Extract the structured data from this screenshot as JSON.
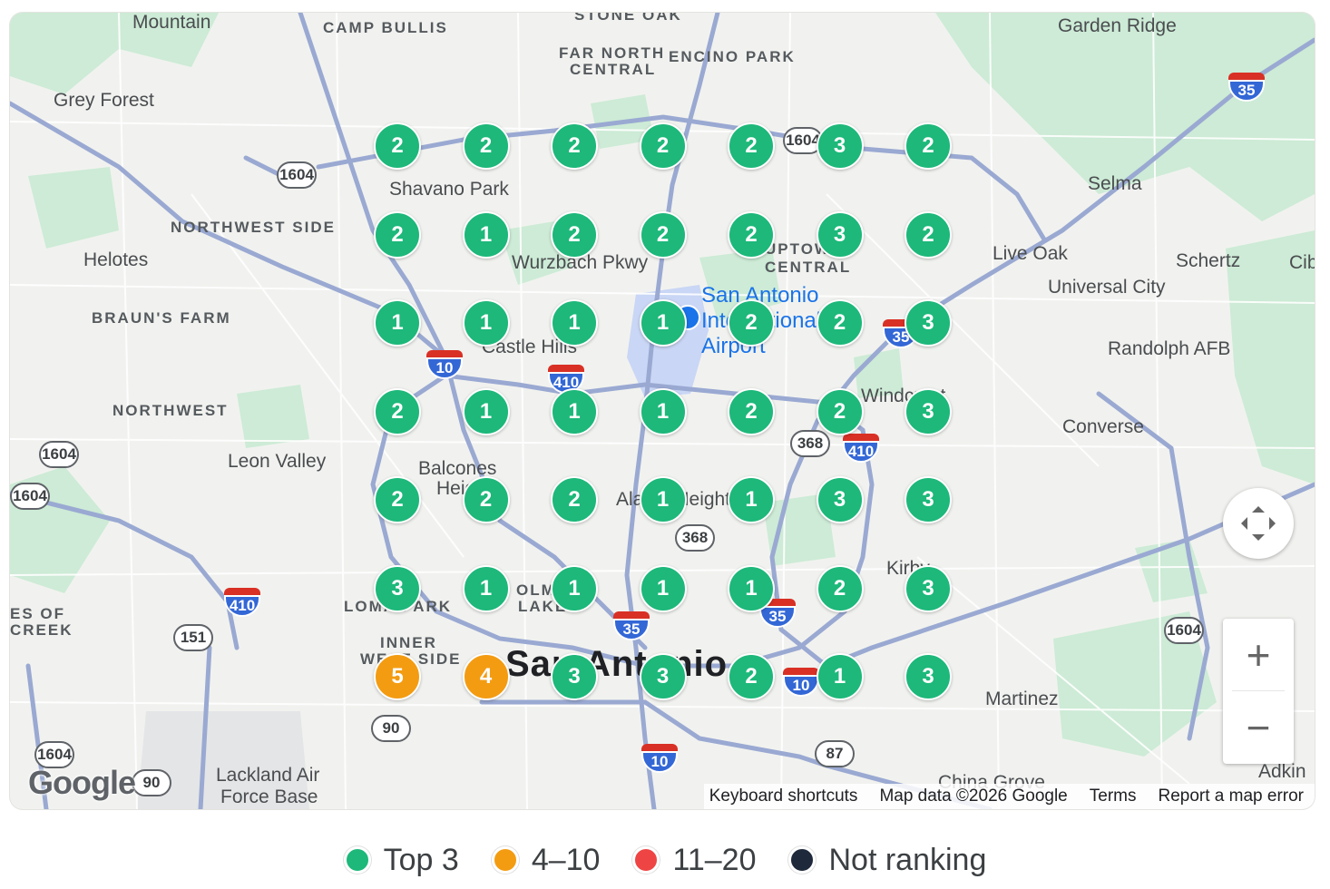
{
  "map": {
    "place_labels": [
      {
        "text": "Mountain",
        "cls": "lbl"
      },
      {
        "text": "CAMP BULLIS",
        "cls": "lbl caps"
      },
      {
        "text": "STONE OAK",
        "cls": "lbl caps"
      },
      {
        "text": "FAR NORTH",
        "cls": "lbl caps"
      },
      {
        "text": "CENTRAL",
        "cls": "lbl caps"
      },
      {
        "text": "ENCINO PARK",
        "cls": "lbl caps"
      },
      {
        "text": "Garden Ridge",
        "cls": "lbl"
      },
      {
        "text": "Grey Forest",
        "cls": "lbl"
      },
      {
        "text": "Shavano Park",
        "cls": "lbl"
      },
      {
        "text": "NORTHWEST SIDE",
        "cls": "lbl caps"
      },
      {
        "text": "Helotes",
        "cls": "lbl"
      },
      {
        "text": "Wurzbach Pkwy",
        "cls": "lbl"
      },
      {
        "text": "UPTOWN",
        "cls": "lbl caps"
      },
      {
        "text": "CENTRAL",
        "cls": "lbl caps"
      },
      {
        "text": "Selma",
        "cls": "lbl"
      },
      {
        "text": "Live Oak",
        "cls": "lbl"
      },
      {
        "text": "Schertz",
        "cls": "lbl"
      },
      {
        "text": "Cib",
        "cls": "lbl"
      },
      {
        "text": "Universal City",
        "cls": "lbl"
      },
      {
        "text": "BRAUN'S FARM",
        "cls": "lbl caps"
      },
      {
        "text": "Castle Hills",
        "cls": "lbl"
      },
      {
        "text": "Randolph AFB",
        "cls": "lbl"
      },
      {
        "text": "NORTHWEST",
        "cls": "lbl caps"
      },
      {
        "text": "Windcrest",
        "cls": "lbl"
      },
      {
        "text": "Converse",
        "cls": "lbl"
      },
      {
        "text": "Leon Valley",
        "cls": "lbl"
      },
      {
        "text": "Balcones",
        "cls": "lbl"
      },
      {
        "text": "Heights",
        "cls": "lbl"
      },
      {
        "text": "Alamo Heights",
        "cls": "lbl"
      },
      {
        "text": "Kirby",
        "cls": "lbl"
      },
      {
        "text": "ES OF",
        "cls": "lbl caps"
      },
      {
        "text": "CREEK",
        "cls": "lbl caps"
      },
      {
        "text": "LOMA PARK",
        "cls": "lbl caps"
      },
      {
        "text": "OLMOS",
        "cls": "lbl caps"
      },
      {
        "text": "LAKE",
        "cls": "lbl caps"
      },
      {
        "text": "INNER",
        "cls": "lbl caps"
      },
      {
        "text": "WEST SIDE",
        "cls": "lbl caps"
      },
      {
        "text": "San Antonio",
        "cls": "lbl big"
      },
      {
        "text": "Martinez",
        "cls": "lbl"
      },
      {
        "text": "Lackland Air",
        "cls": "lbl"
      },
      {
        "text": "Force Base",
        "cls": "lbl"
      },
      {
        "text": "China Grove",
        "cls": "lbl"
      },
      {
        "text": "Adkin",
        "cls": "lbl"
      }
    ],
    "airport_label": [
      "San Antonio",
      "International",
      "Airport"
    ],
    "route_shields": [
      "1604",
      "1604",
      "1604",
      "1604",
      "1604",
      "368",
      "368",
      "151",
      "90",
      "87",
      "90",
      "1604"
    ],
    "interstate_shields": [
      "35",
      "10",
      "410",
      "35",
      "410",
      "410",
      "35",
      "35",
      "10",
      "10"
    ],
    "google_logo": "Google",
    "attribution": [
      "Keyboard shortcuts",
      "Map data ©2026 Google",
      "Terms",
      "Report a map error"
    ],
    "controls": {
      "zoom_in": "+",
      "zoom_out": "−",
      "fullscreen": "fullscreen-icon"
    }
  },
  "grid": {
    "columns": 7,
    "rows": 7,
    "ranks": [
      [
        2,
        2,
        2,
        2,
        2,
        3,
        2
      ],
      [
        2,
        1,
        2,
        2,
        2,
        3,
        2
      ],
      [
        1,
        1,
        1,
        1,
        2,
        2,
        3
      ],
      [
        2,
        1,
        1,
        1,
        2,
        2,
        3
      ],
      [
        2,
        2,
        2,
        1,
        1,
        3,
        3
      ],
      [
        3,
        1,
        1,
        1,
        1,
        2,
        3
      ],
      [
        5,
        4,
        3,
        3,
        2,
        1,
        3
      ]
    ]
  },
  "legend": [
    {
      "label": "Top 3",
      "color": "#1db87a"
    },
    {
      "label": "4–10",
      "color": "#f39c12"
    },
    {
      "label": "11–20",
      "color": "#ef4444"
    },
    {
      "label": "Not ranking",
      "color": "#1e293b"
    }
  ]
}
